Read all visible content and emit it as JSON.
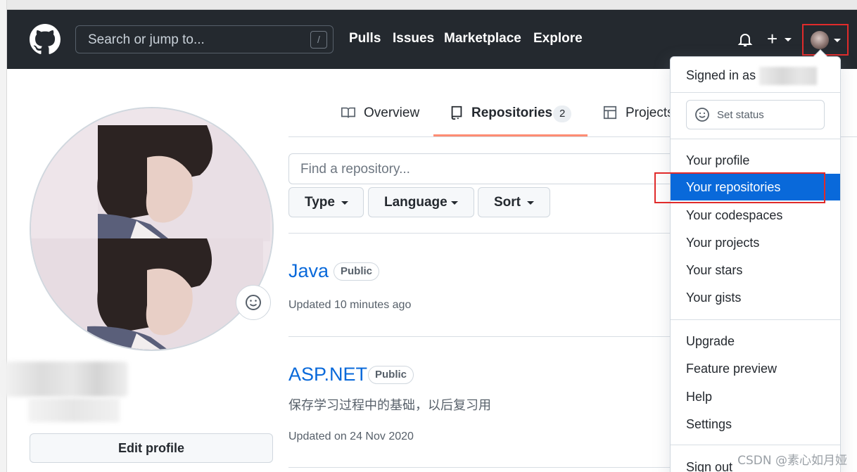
{
  "header": {
    "search_placeholder": "Search or jump to...",
    "search_shortcut": "/",
    "nav": [
      "Pulls",
      "Issues",
      "Marketplace",
      "Explore"
    ],
    "plus_label": "+"
  },
  "tabs": {
    "overview": "Overview",
    "repositories": "Repositories",
    "repositories_count": "2",
    "projects": "Projects"
  },
  "filter": {
    "find_placeholder": "Find a repository...",
    "type": "Type",
    "language": "Language",
    "sort": "Sort"
  },
  "repos": [
    {
      "name": "Java",
      "visibility": "Public",
      "description": "",
      "updated": "Updated 10 minutes ago"
    },
    {
      "name": "ASP.NET",
      "visibility": "Public",
      "description": "保存学习过程中的基础，以后复习用",
      "updated": "Updated on 24 Nov 2020"
    }
  ],
  "profile": {
    "edit_label": "Edit profile"
  },
  "dropdown": {
    "signed_in": "Signed in as",
    "set_status": "Set status",
    "items": [
      "Your profile",
      "Your repositories",
      "Your codespaces",
      "Your projects",
      "Your stars",
      "Your gists"
    ],
    "selected": "Your repositories",
    "items2": [
      "Upgrade",
      "Feature preview",
      "Help",
      "Settings"
    ],
    "sign_out": "Sign out"
  },
  "watermark": "CSDN @素心如月娅",
  "colors": {
    "header_bg": "#24292f",
    "link": "#0969da",
    "tab_underline": "#fd8c73",
    "highlight": "#e02b2b"
  }
}
